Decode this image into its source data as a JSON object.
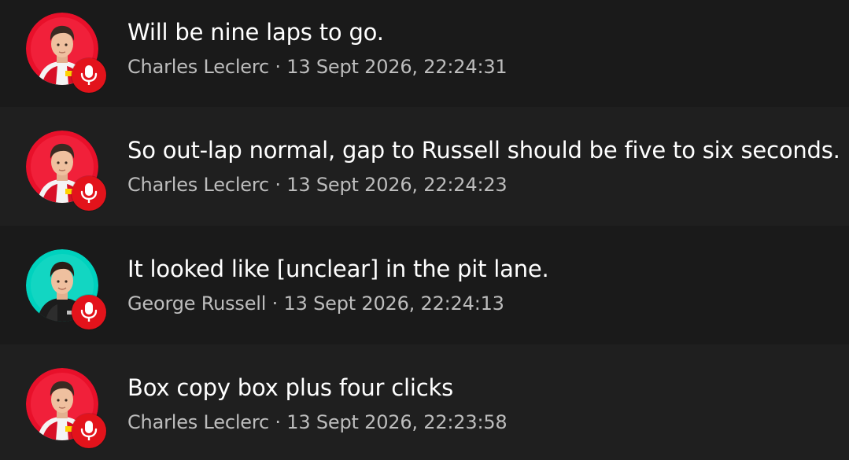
{
  "separator": " · ",
  "messages": [
    {
      "text": "Will be nine laps to go.",
      "driver": "Charles Leclerc",
      "timestamp": "13 Sept 2026, 22:24:31",
      "team_color": "#e8102a",
      "avatar_icon": "driver-avatar-leclerc",
      "badge_icon": "microphone-icon"
    },
    {
      "text": "So out-lap normal, gap to Russell should be five to six seconds.",
      "driver": "Charles Leclerc",
      "timestamp": "13 Sept 2026, 22:24:23",
      "team_color": "#e8102a",
      "avatar_icon": "driver-avatar-leclerc",
      "badge_icon": "microphone-icon"
    },
    {
      "text": "It looked like [unclear] in the pit lane.",
      "driver": "George Russell",
      "timestamp": "13 Sept 2026, 22:24:13",
      "team_color": "#00d2be",
      "avatar_icon": "driver-avatar-russell",
      "badge_icon": "microphone-icon"
    },
    {
      "text": "Box copy box plus four clicks",
      "driver": "Charles Leclerc",
      "timestamp": "13 Sept 2026, 22:23:58",
      "team_color": "#e8102a",
      "avatar_icon": "driver-avatar-leclerc",
      "badge_icon": "microphone-icon"
    }
  ],
  "colors": {
    "background": "#1f1f1f",
    "row_alt": "#1a1a1a",
    "text_primary": "#ffffff",
    "text_secondary": "#bdbdbd",
    "badge": "#e3131b"
  }
}
